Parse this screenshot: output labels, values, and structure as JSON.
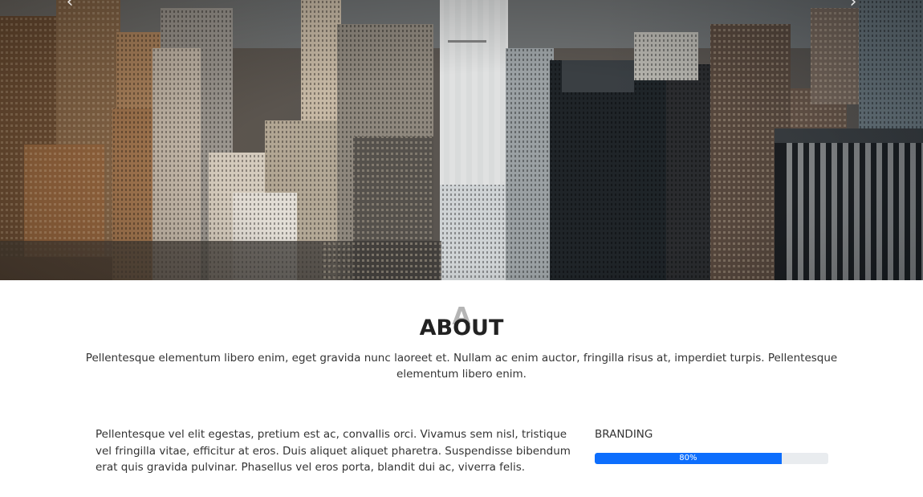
{
  "hero": {
    "image": "city-skyline-photo",
    "prev_icon": "chevron-left-icon",
    "next_icon": "chevron-right-icon",
    "prev_glyph": "‹",
    "next_glyph": "›"
  },
  "about": {
    "watermark": "A",
    "title": "ABOUT",
    "intro": "Pellentesque elementum libero enim, eget gravida nunc laoreet et. Nullam ac enim auctor, fringilla risus at, imperdiet turpis. Pellentesque elementum libero enim.",
    "body": "Pellentesque vel elit egestas, pretium est ac, convallis orci. Vivamus sem nisl, tristique vel fringilla vitae, efficitur at eros. Duis aliquet aliquet pharetra. Suspendisse bibendum erat quis gravida pulvinar. Phasellus vel eros porta, blandit dui ac, viverra felis.",
    "skills": [
      {
        "label": "BRANDING",
        "value": 80,
        "value_text": "80%"
      }
    ]
  },
  "colors": {
    "progress_fill": "#0d6efd",
    "progress_track": "#e9ecef",
    "title_underline": "#777777"
  }
}
